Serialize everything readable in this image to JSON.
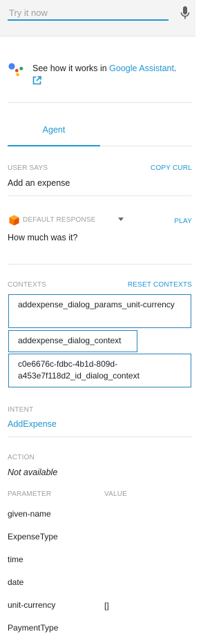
{
  "try_it": {
    "placeholder": "Try it now"
  },
  "assistant_promo": {
    "text": "See how it works in ",
    "link_text": "Google Assistant",
    "suffix": "."
  },
  "tabs": [
    {
      "label": "Agent"
    }
  ],
  "user_says": {
    "label": "USER SAYS",
    "action_label": "COPY CURL",
    "value": "Add an expense"
  },
  "response": {
    "label": "DEFAULT RESPONSE",
    "action_label": "PLAY",
    "value": "How much was it?"
  },
  "contexts": {
    "label": "CONTEXTS",
    "action_label": "RESET CONTEXTS",
    "items": [
      "addexpense_dialog_params_unit-currency",
      "addexpense_dialog_context",
      "c0e6676c-fdbc-4b1d-809d-a453e7f118d2_id_dialog_context"
    ]
  },
  "intent": {
    "label": "INTENT",
    "value": "AddExpense"
  },
  "action": {
    "label": "ACTION",
    "value": "Not available"
  },
  "parameters": {
    "name_header": "PARAMETER",
    "value_header": "VALUE",
    "rows": [
      {
        "name": "given-name",
        "value": ""
      },
      {
        "name": "ExpenseType",
        "value": ""
      },
      {
        "name": "time",
        "value": ""
      },
      {
        "name": "date",
        "value": ""
      },
      {
        "name": "unit-currency",
        "value": "[]"
      },
      {
        "name": "PaymentType",
        "value": ""
      }
    ]
  },
  "colors": {
    "accent": "#2196d3",
    "context_border": "#2681b8",
    "muted": "#9e9e9e"
  },
  "icons": [
    "microphone-icon",
    "google-assistant-icon",
    "external-link-icon",
    "cube-icon",
    "chevron-down-icon"
  ]
}
